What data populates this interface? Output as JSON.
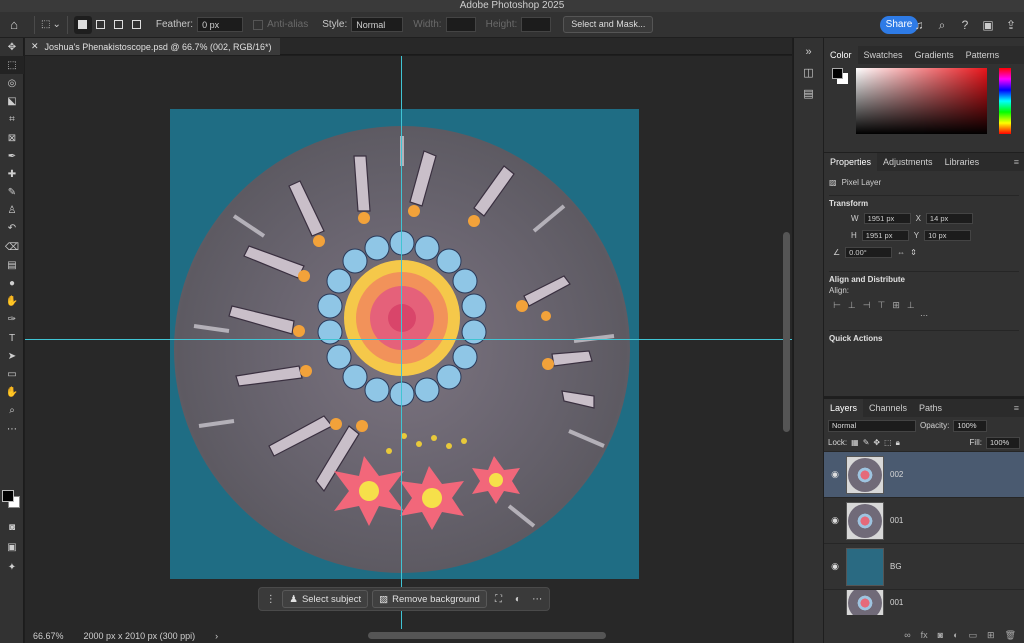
{
  "app": {
    "title": "Adobe Photoshop 2025"
  },
  "options_bar": {
    "feather_label": "Feather:",
    "feather_value": "0 px",
    "antialias_label": "Anti-alias",
    "style_label": "Style:",
    "style_value": "Normal",
    "width_label": "Width:",
    "height_label": "Height:",
    "select_mask_label": "Select and Mask...",
    "share_label": "Share"
  },
  "document": {
    "tab_title": "Joshua's Phenakistoscope.psd @ 66.7% (002, RGB/16*)",
    "zoom": "66.67%",
    "dimensions": "2000 px x 2010 px (300 ppi)"
  },
  "contextual_bar": {
    "select_subject": "Select subject",
    "remove_background": "Remove background"
  },
  "color_panel": {
    "tabs": [
      "Color",
      "Swatches",
      "Gradients",
      "Patterns"
    ],
    "accent_red": "#e8141a"
  },
  "properties_panel": {
    "tabs": [
      "Properties",
      "Adjustments",
      "Libraries"
    ],
    "layer_type": "Pixel Layer",
    "transform_title": "Transform",
    "w_label": "W",
    "w_value": "1951 px",
    "h_label": "H",
    "h_value": "1951 px",
    "x_label": "X",
    "x_value": "14 px",
    "y_label": "Y",
    "y_value": "10 px",
    "angle_value": "0.00°",
    "align_title": "Align and Distribute",
    "align_label": "Align:",
    "quick_actions_title": "Quick Actions"
  },
  "layers_panel": {
    "tabs": [
      "Layers",
      "Channels",
      "Paths"
    ],
    "blend_mode": "Normal",
    "opacity_label": "Opacity:",
    "opacity_value": "100%",
    "lock_label": "Lock:",
    "fill_label": "Fill:",
    "fill_value": "100%",
    "layers": [
      {
        "name": "002",
        "selected": true
      },
      {
        "name": "001",
        "selected": false
      },
      {
        "name": "BG",
        "selected": false
      },
      {
        "name": "001",
        "selected": false
      }
    ]
  },
  "colors": {
    "canvas_bg": "#1f6d84",
    "guide": "#40c4d4",
    "share_blue": "#2e7be6",
    "selection": "#4a5a70"
  }
}
